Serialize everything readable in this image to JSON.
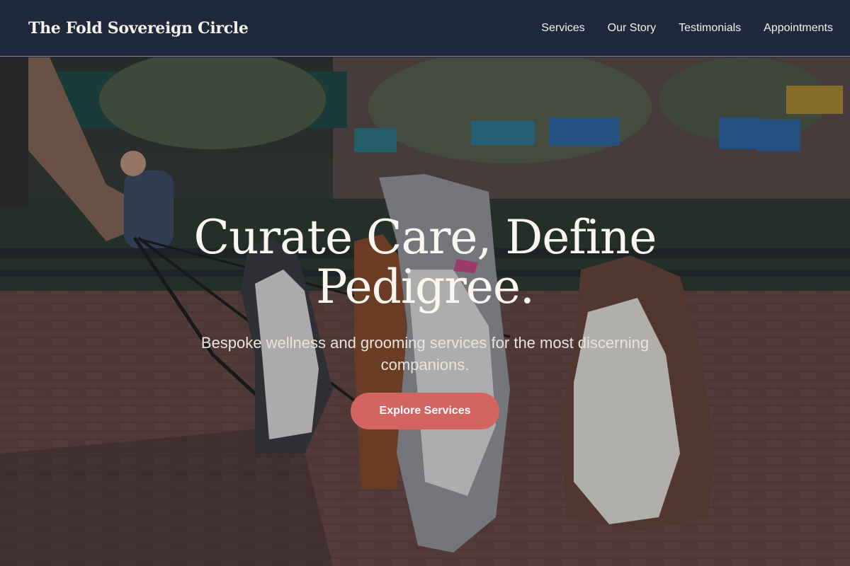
{
  "header": {
    "brand": "The Fold Sovereign Circle",
    "nav": [
      {
        "label": "Services"
      },
      {
        "label": "Our Story"
      },
      {
        "label": "Testimonials"
      },
      {
        "label": "Appointments"
      }
    ]
  },
  "hero": {
    "title": "Curate Care, Define Pedigree.",
    "subtitle": "Bespoke wellness and grooming services for the most discerning companions.",
    "cta_label": "Explore Services"
  },
  "colors": {
    "nav_bg": "#1e2a3c",
    "cta": "#d4645f",
    "title_text": "#fbf6ef"
  }
}
